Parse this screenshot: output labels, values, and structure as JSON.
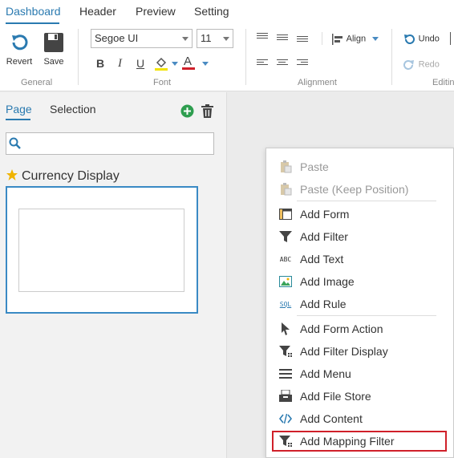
{
  "tabs": [
    "Dashboard",
    "Header",
    "Preview",
    "Setting"
  ],
  "ribbon": {
    "revert_label": "Revert",
    "save_label": "Save",
    "general_label": "General",
    "font_family": "Segoe UI",
    "font_size": "11",
    "bold": "B",
    "italic": "I",
    "underline": "U",
    "font_color": "A",
    "font_label": "Font",
    "align_label": "Align",
    "alignment_label": "Alignment",
    "undo_label": "Undo",
    "redo_label": "Redo",
    "editing_label": "Editin",
    "accent": "#2a7ab0"
  },
  "panel": {
    "tabs": [
      "Page",
      "Selection"
    ],
    "search_value": "",
    "item_title": "Currency Display"
  },
  "menu": {
    "items": [
      {
        "label": "Paste",
        "icon": "paste-icon",
        "disabled": true
      },
      {
        "label": "Paste (Keep Position)",
        "icon": "paste-keep-icon",
        "disabled": true
      },
      {
        "label": "Add Form",
        "icon": "form-icon",
        "disabled": false
      },
      {
        "label": "Add Filter",
        "icon": "filter-icon",
        "disabled": false
      },
      {
        "label": "Add Text",
        "icon": "text-abc-icon",
        "disabled": false
      },
      {
        "label": "Add Image",
        "icon": "image-icon",
        "disabled": false
      },
      {
        "label": "Add Rule",
        "icon": "sql-icon",
        "disabled": false
      },
      {
        "label": "Add Form Action",
        "icon": "cursor-icon",
        "disabled": false
      },
      {
        "label": "Add Filter Display",
        "icon": "filter-display-icon",
        "disabled": false
      },
      {
        "label": "Add Menu",
        "icon": "menu-icon",
        "disabled": false
      },
      {
        "label": "Add File Store",
        "icon": "file-store-icon",
        "disabled": false
      },
      {
        "label": "Add Content",
        "icon": "code-icon",
        "disabled": false
      },
      {
        "label": "Add Mapping Filter",
        "icon": "mapping-filter-icon",
        "disabled": false
      }
    ],
    "icon_abc": "ABC",
    "icon_sql": "SQL",
    "highlight_color": "#d0202a"
  }
}
